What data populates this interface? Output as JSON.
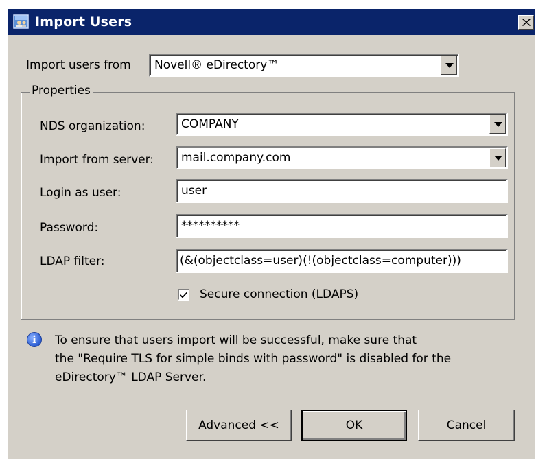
{
  "window": {
    "title": "Import Users",
    "title_bar_color": "#0a246a",
    "face_color": "#d4d0c8",
    "icon": "users-import-icon",
    "close_icon": "close-icon"
  },
  "source": {
    "label": "Import users from",
    "value": "Novell® eDirectory™"
  },
  "properties": {
    "legend": "Properties",
    "nds_org": {
      "label": "NDS organization:",
      "value": "COMPANY"
    },
    "server": {
      "label": "Import from server:",
      "value": "mail.company.com"
    },
    "login": {
      "label": "Login as user:",
      "value": "user"
    },
    "password": {
      "label": "Password:",
      "value": "**********"
    },
    "ldap_filter": {
      "label": "LDAP filter:",
      "value": "(&(objectclass=user)(!(objectclass=computer)))"
    },
    "secure": {
      "label": "Secure connection (LDAPS)",
      "checked": true
    }
  },
  "info": {
    "icon": "info-icon",
    "line1": "To ensure that users import will be successful, make sure that",
    "line2": "the \"Require TLS for simple binds with password\" is disabled for the",
    "line3": "eDirectory™ LDAP Server."
  },
  "buttons": {
    "advanced": "Advanced <<",
    "ok": "OK",
    "cancel": "Cancel"
  }
}
